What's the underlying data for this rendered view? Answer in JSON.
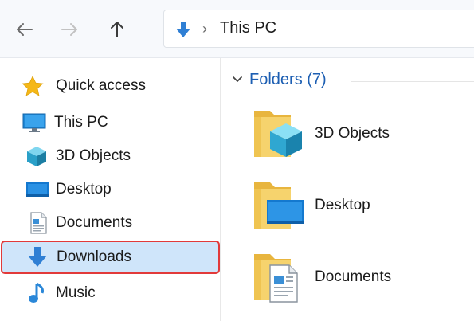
{
  "toolbar": {
    "back_icon": "arrow-left-icon",
    "forward_icon": "arrow-right-icon",
    "up_icon": "arrow-up-icon",
    "address": {
      "location_icon": "downloads-arrow-icon",
      "separator": "›",
      "location": "This PC"
    }
  },
  "sidebar": {
    "items": [
      {
        "label": "Quick access",
        "icon": "star-icon"
      },
      {
        "label": "This PC",
        "icon": "monitor-icon"
      },
      {
        "label": "3D Objects",
        "icon": "cube-icon"
      },
      {
        "label": "Desktop",
        "icon": "desktop-icon"
      },
      {
        "label": "Documents",
        "icon": "document-icon"
      },
      {
        "label": "Downloads",
        "icon": "download-arrow-icon",
        "selected": true
      },
      {
        "label": "Music",
        "icon": "music-note-icon"
      }
    ]
  },
  "main": {
    "section": {
      "title": "Folders (7)",
      "chevron": "chevron-down-icon"
    },
    "folders": [
      {
        "label": "3D Objects",
        "icon": "folder-3d-objects-icon"
      },
      {
        "label": "Desktop",
        "icon": "folder-desktop-icon"
      },
      {
        "label": "Documents",
        "icon": "folder-documents-icon"
      }
    ]
  },
  "colors": {
    "accent": "#1d5fb3",
    "selection_bg": "#cfe5fa",
    "selection_outline": "#e23a3a",
    "folder_yellow": "#f3c954"
  }
}
